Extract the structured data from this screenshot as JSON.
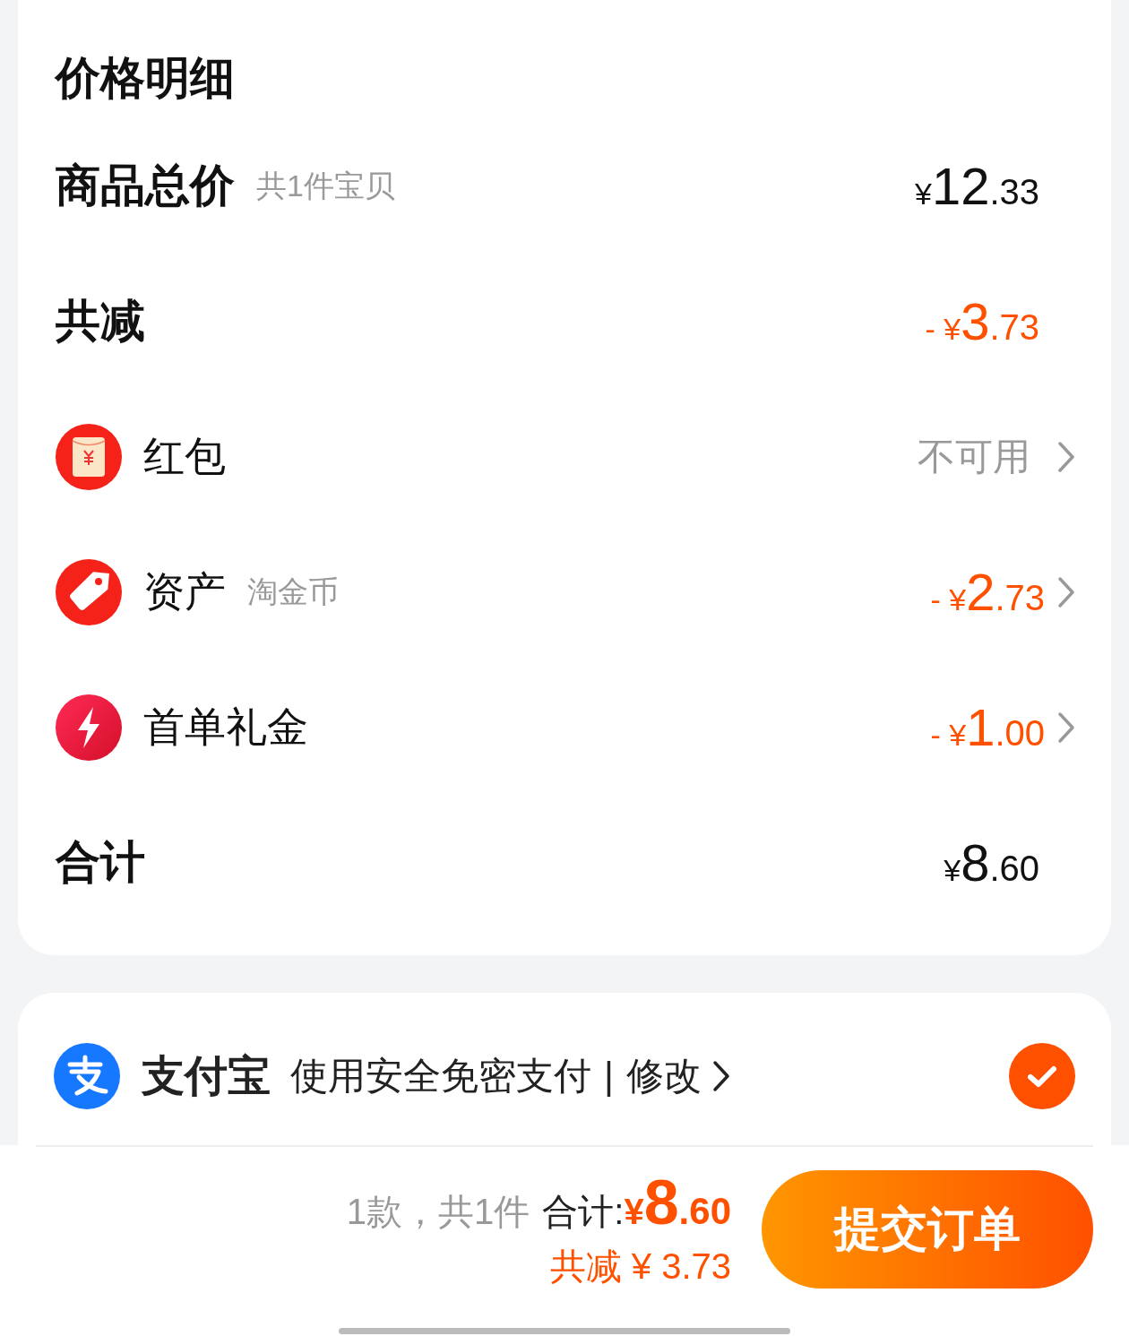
{
  "price_detail": {
    "title": "价格明细",
    "rows": [
      {
        "kind": "summary",
        "label": "商品总价",
        "note": "共1件宝贝",
        "amount": {
          "prefix": "¥",
          "integer": "12",
          "decimal": ".33"
        },
        "discount": false,
        "chevron": false
      },
      {
        "kind": "summary",
        "label": "共减",
        "amount": {
          "prefix": "- ¥",
          "integer": "3",
          "decimal": ".73"
        },
        "discount": true,
        "chevron": false
      },
      {
        "kind": "envelope",
        "label": "红包",
        "status": "不可用",
        "chevron": true
      },
      {
        "kind": "tag",
        "label": "资产",
        "note": "淘金币",
        "amount": {
          "prefix": "- ¥",
          "integer": "2",
          "decimal": ".73"
        },
        "discount": true,
        "chevron": true
      },
      {
        "kind": "bolt",
        "label": "首单礼金",
        "amount": {
          "prefix": "- ¥",
          "integer": "1",
          "decimal": ".00"
        },
        "discount": true,
        "chevron": true
      },
      {
        "kind": "summary",
        "label": "合计",
        "amount": {
          "prefix": "¥",
          "integer": "8",
          "decimal": ".60"
        },
        "discount": false,
        "chevron": false
      }
    ]
  },
  "payment": {
    "method": "支付宝",
    "description": "使用安全免密支付",
    "divider": "|",
    "link": "修改",
    "selected": true
  },
  "footer": {
    "count": "1款，共1件",
    "total_label": "合计:",
    "total": {
      "prefix": "¥",
      "integer": "8",
      "decimal": ".60"
    },
    "saved": "共减 ¥ 3.73",
    "submit": "提交订单"
  }
}
